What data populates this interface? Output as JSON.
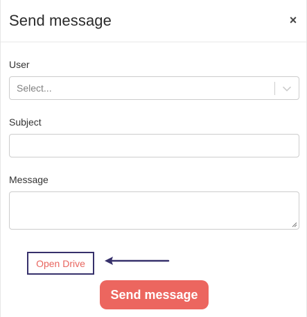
{
  "modal": {
    "title": "Send message",
    "close_label": "×"
  },
  "form": {
    "user": {
      "label": "User",
      "placeholder": "Select..."
    },
    "subject": {
      "label": "Subject",
      "value": ""
    },
    "message": {
      "label": "Message",
      "value": ""
    }
  },
  "actions": {
    "open_drive_label": "Open Drive",
    "send_label": "Send message"
  },
  "colors": {
    "accent": "#ec665f",
    "drive_border": "#36306b",
    "arrow": "#36306b"
  },
  "icons": {
    "close": "close-icon",
    "dropdown": "chevron-down-icon",
    "arrow": "arrow-left-icon"
  }
}
